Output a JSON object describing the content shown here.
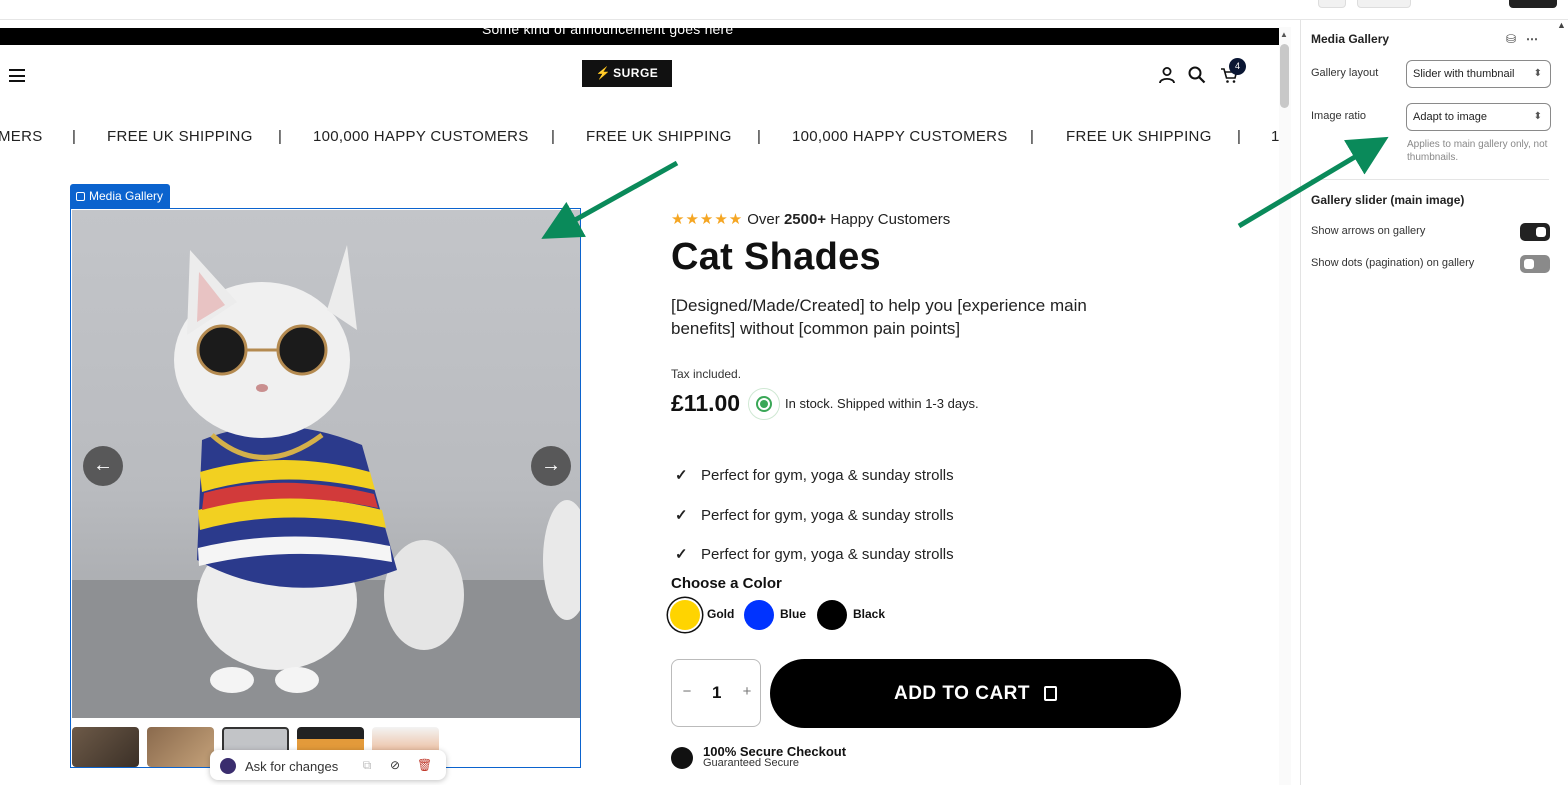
{
  "announcement": "Some kind of announcement goes here",
  "header": {
    "logo_text": "SURGE",
    "cart_count": "4"
  },
  "marquee": {
    "items": [
      "MERS",
      "|",
      "FREE UK SHIPPING",
      "|",
      "100,000 HAPPY CUSTOMERS",
      "|",
      "FREE UK SHIPPING",
      "|",
      "100,000 HAPPY CUSTOMERS",
      "|",
      "FREE UK SHIPPING",
      "|",
      "1"
    ]
  },
  "gallery": {
    "tag_label": "Media Gallery",
    "prev_arrow": "←",
    "next_arrow": "→",
    "ask_label": "Ask for changes"
  },
  "product": {
    "stars": "★★★★★",
    "rating_prefix": "Over",
    "rating_count": "2500+",
    "rating_suffix": "Happy Customers",
    "title": "Cat Shades",
    "description": "[Designed/Made/Created] to help you [experience main benefits] without [common pain points]",
    "tax_note": "Tax included.",
    "price": "£11.00",
    "stock_text": "In stock. Shipped within 1-3 days.",
    "bullets": [
      "Perfect for gym, yoga & sunday strolls",
      "Perfect for gym, yoga & sunday strolls",
      "Perfect for gym, yoga & sunday strolls"
    ],
    "color_label": "Choose a Color",
    "colors": [
      {
        "name": "Gold",
        "hex": "#ffd400",
        "selected": true
      },
      {
        "name": "Blue",
        "hex": "#0033ff",
        "selected": false
      },
      {
        "name": "Black",
        "hex": "#000000",
        "selected": false
      }
    ],
    "quantity": "1",
    "qty_minus": "−",
    "qty_plus": "+",
    "add_to_cart": "ADD TO CART",
    "secure_title": "100% Secure Checkout",
    "secure_sub": "Guaranteed Secure"
  },
  "panel": {
    "title": "Media Gallery",
    "gallery_layout_label": "Gallery layout",
    "gallery_layout_value": "Slider with thumbnail",
    "image_ratio_label": "Image ratio",
    "image_ratio_value": "Adapt to image",
    "image_ratio_help": "Applies to main gallery only, not thumbnails.",
    "slider_section": "Gallery slider (main image)",
    "show_arrows_label": "Show arrows on gallery",
    "show_arrows_on": true,
    "show_dots_label": "Show dots (pagination) on gallery",
    "show_dots_on": false
  },
  "colors": {
    "accent_blue": "#0b63ce",
    "annotation_green": "#0a8a5a",
    "star": "#f5a623",
    "in_stock": "#3aa757"
  }
}
